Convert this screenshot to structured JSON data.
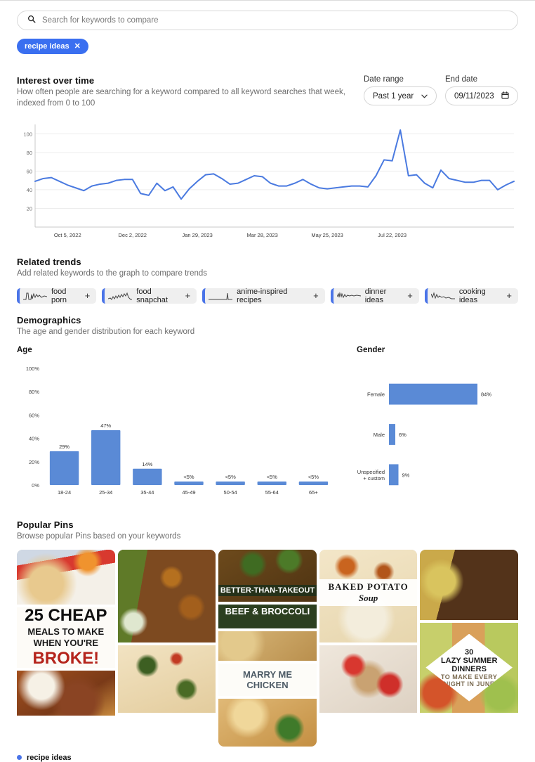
{
  "search": {
    "placeholder": "Search for keywords to compare",
    "icon": "search-icon",
    "value": ""
  },
  "keyword_chips": [
    {
      "label": "recipe ideas",
      "remove": "✕"
    }
  ],
  "interest_over_time": {
    "title": "Interest over time",
    "subtitle": "How often people are searching for a keyword compared to all keyword searches that week, indexed from 0 to 100",
    "date_range": {
      "label": "Date range",
      "value": "Past 1 year",
      "icon": "chevron-down-icon"
    },
    "end_date": {
      "label": "End date",
      "value": "09/11/2023",
      "icon": "calendar-icon"
    }
  },
  "related_trends": {
    "title": "Related trends",
    "subtitle": "Add related keywords to the graph to compare trends",
    "chips": [
      {
        "label": "food porn",
        "add": "+"
      },
      {
        "label": "food snapchat",
        "add": "+"
      },
      {
        "label": "anime-inspired recipes",
        "add": "+"
      },
      {
        "label": "dinner ideas",
        "add": "+"
      },
      {
        "label": "cooking ideas",
        "add": "+"
      }
    ]
  },
  "demographics": {
    "title": "Demographics",
    "subtitle": "The age and gender distribution for each keyword",
    "age_title": "Age",
    "gender_title": "Gender"
  },
  "popular_pins": {
    "title": "Popular Pins",
    "subtitle": "Browse popular Pins based on your keywords",
    "pins": [
      {
        "caption": "25 CHEAP MEALS TO MAKE WHEN YOU'RE BROKE!",
        "caption_lines": [
          "25 CHEAP",
          "MEALS TO MAKE",
          "WHEN YOU'RE",
          "BROKE!"
        ]
      },
      {
        "caption": "BETTER-THAN-TAKEOUT BEEF & BROCCOLI",
        "caption_lines": [
          "BETTER-THAN-TAKEOUT",
          "BEEF & BROCCOLI"
        ]
      },
      {
        "caption": "BAKED POTATO Soup",
        "caption_lines": [
          "BAKED POTATO",
          "Soup"
        ]
      },
      {
        "caption": "MARRY ME CHICKEN",
        "caption_lines": [
          "MARRY ME",
          "CHICKEN"
        ]
      },
      {
        "caption": "30 LAZY SUMMER DINNERS TO MAKE EVERY NIGHT IN JUNE",
        "caption_lines": [
          "30",
          "LAZY SUMMER",
          "DINNERS",
          "TO MAKE EVERY",
          "NIGHT IN JUNE"
        ]
      }
    ]
  },
  "legend": [
    {
      "label": "recipe ideas",
      "color": "#4a74e8"
    }
  ],
  "colors": {
    "line": "#4a7ae0",
    "bar": "#5a8ad6",
    "chip": "#3a6ff0",
    "accent": "#4a74e8",
    "grid": "#ededed",
    "axis_text": "#6b6b6b"
  },
  "chart_data": [
    {
      "id": "interest-over-time",
      "type": "line",
      "title": "Interest over time",
      "xlabel": "",
      "ylabel": "",
      "ylim": [
        0,
        110
      ],
      "yticks": [
        20,
        40,
        60,
        80,
        100
      ],
      "grid": true,
      "legend_position": "bottom",
      "xticks": [
        "Oct 5, 2022",
        "Dec 2, 2022",
        "Jan 29, 2023",
        "Mar 28, 2023",
        "May 25, 2023",
        "Jul 22, 2023"
      ],
      "xtick_index": [
        4,
        12,
        20,
        28,
        36,
        44
      ],
      "series": [
        {
          "name": "recipe ideas",
          "color": "#4a7ae0",
          "values": [
            49,
            52,
            53,
            49,
            45,
            42,
            39,
            44,
            46,
            47,
            50,
            51,
            51,
            36,
            34,
            47,
            39,
            43,
            30,
            41,
            49,
            56,
            57,
            52,
            46,
            47,
            51,
            55,
            54,
            47,
            44,
            44,
            47,
            51,
            46,
            42,
            41,
            42,
            43,
            44,
            44,
            43,
            55,
            72,
            71,
            104,
            55,
            56,
            47,
            42,
            61,
            52,
            50,
            48,
            48,
            50,
            50,
            40,
            45,
            49
          ]
        }
      ]
    },
    {
      "id": "age-distribution",
      "type": "bar",
      "title": "Age",
      "xlabel": "",
      "ylabel": "",
      "ylim": [
        0,
        100
      ],
      "yticks": [
        0,
        20,
        40,
        60,
        80,
        100
      ],
      "ytick_labels": [
        "0%",
        "20%",
        "40%",
        "60%",
        "80%",
        "100%"
      ],
      "grid": false,
      "categories": [
        "18-24",
        "25-34",
        "35-44",
        "45-49",
        "50-54",
        "55-64",
        "65+"
      ],
      "values": [
        29,
        47,
        14,
        2,
        2,
        2,
        2
      ],
      "data_labels": [
        "29%",
        "47%",
        "14%",
        "<5%",
        "<5%",
        "<5%",
        "<5%"
      ],
      "color": "#5a8ad6"
    },
    {
      "id": "gender-distribution",
      "type": "bar",
      "orientation": "horizontal",
      "title": "Gender",
      "xlabel": "",
      "ylabel": "",
      "xlim": [
        0,
        100
      ],
      "grid": false,
      "categories": [
        "Female",
        "Male",
        "Unspecified + custom"
      ],
      "category_lines": [
        [
          "Female"
        ],
        [
          "Male"
        ],
        [
          "Unspecified",
          "+ custom"
        ]
      ],
      "values": [
        84,
        6,
        9
      ],
      "data_labels": [
        "84%",
        "6%",
        "9%"
      ],
      "color": "#5a8ad6"
    }
  ]
}
